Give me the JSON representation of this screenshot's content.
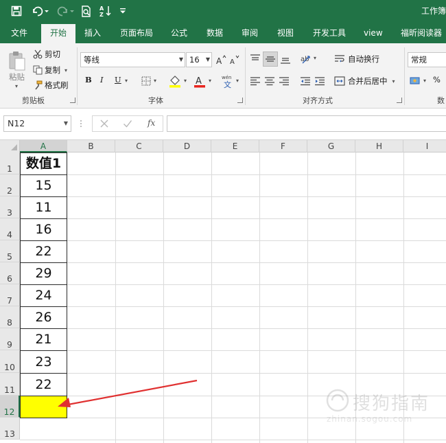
{
  "window": {
    "title": "工作簿"
  },
  "ribbon_tabs": [
    "文件",
    "开始",
    "插入",
    "页面布局",
    "公式",
    "数据",
    "审阅",
    "视图",
    "开发工具",
    "view",
    "福昕阅读器"
  ],
  "active_tab": "开始",
  "clipboard": {
    "paste_label": "粘贴",
    "cut_label": "剪切",
    "copy_label": "复制",
    "format_painter_label": "格式刷",
    "group_label": "剪贴板"
  },
  "font": {
    "font_name": "等线",
    "font_size": "16",
    "bold": "B",
    "italic": "I",
    "underline": "U",
    "group_label": "字体",
    "font_color": "#e8251f",
    "fill_color": "#ffff00"
  },
  "alignment": {
    "wrap_text_label": "自动换行",
    "merge_center_label": "合并后居中",
    "group_label": "对齐方式"
  },
  "number": {
    "format_value": "常规",
    "percent_symbol": "%",
    "group_label_partial": "数"
  },
  "formula_bar": {
    "name_box": "N12",
    "formula": ""
  },
  "sheet": {
    "columns": [
      "A",
      "B",
      "C",
      "D",
      "E",
      "F",
      "G",
      "H",
      "I"
    ],
    "rows": [
      "1",
      "2",
      "3",
      "4",
      "5",
      "6",
      "7",
      "8",
      "9",
      "10",
      "11",
      "12",
      "13"
    ],
    "header_cell": "数值1",
    "values": [
      "15",
      "11",
      "16",
      "22",
      "29",
      "24",
      "26",
      "21",
      "23",
      "22"
    ],
    "highlight_color": "#ffff00",
    "arrow_color": "#e03030"
  },
  "watermark": {
    "text": "搜狗指南",
    "url": "zhinan.sogou.com"
  },
  "colors": {
    "accent": "#217346",
    "ribbon_bg": "#f3f3f3"
  }
}
